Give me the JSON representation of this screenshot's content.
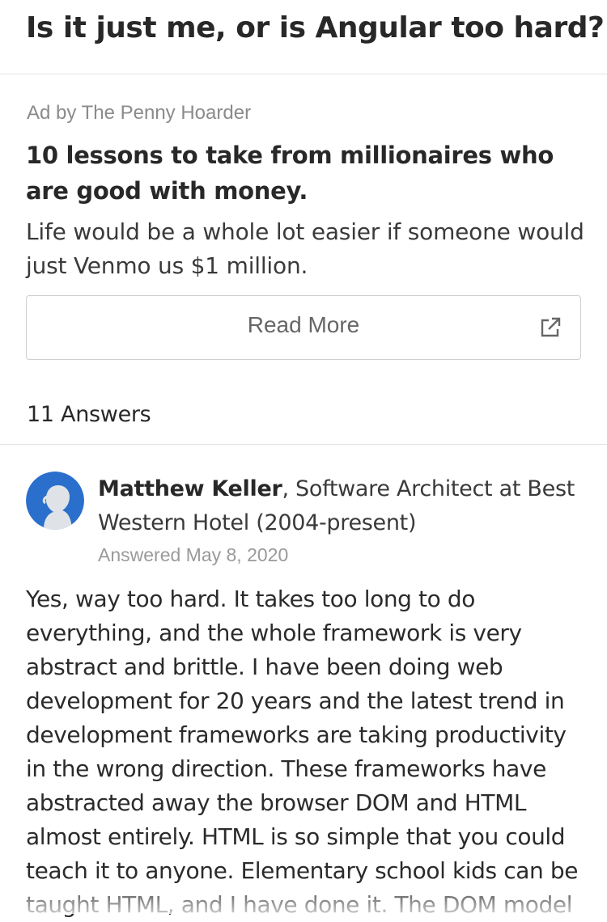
{
  "question": {
    "title": "Is it just me, or is Angular too hard?"
  },
  "ad": {
    "label": "Ad by The Penny Hoarder",
    "title": "10 lessons to take from millionaires who are good with money.",
    "body": "Life would be a whole lot easier if someone would just Venmo us $1 million.",
    "button_label": "Read More",
    "button_icon": "external-link-icon"
  },
  "answers": {
    "count_label": "11 Answers"
  },
  "answer": {
    "author_name": "Matthew Keller",
    "author_credential": ", Software Architect at Best Western Hotel (2004-present)",
    "answered_date": "Answered May 8, 2020",
    "avatar_icon": "default-user-avatar-icon",
    "text": "Yes, way too hard. It takes too long to do everything, and the whole framework is very abstract and brittle. I have been doing web development for 20 years and the latest trend in development frameworks are taking productivity in the wrong direction. These frameworks have abstracted away the browser DOM and HTML almost entirely. HTML is so simple that you could teach it to anyone. Elementary school kids can be taught HTML, and I have done it. The DOM model"
  },
  "colors": {
    "avatar_blue": "#2a6fcb",
    "text_dark": "#282829",
    "text_muted": "#8b8b8b",
    "divider": "#e3e3e3"
  }
}
